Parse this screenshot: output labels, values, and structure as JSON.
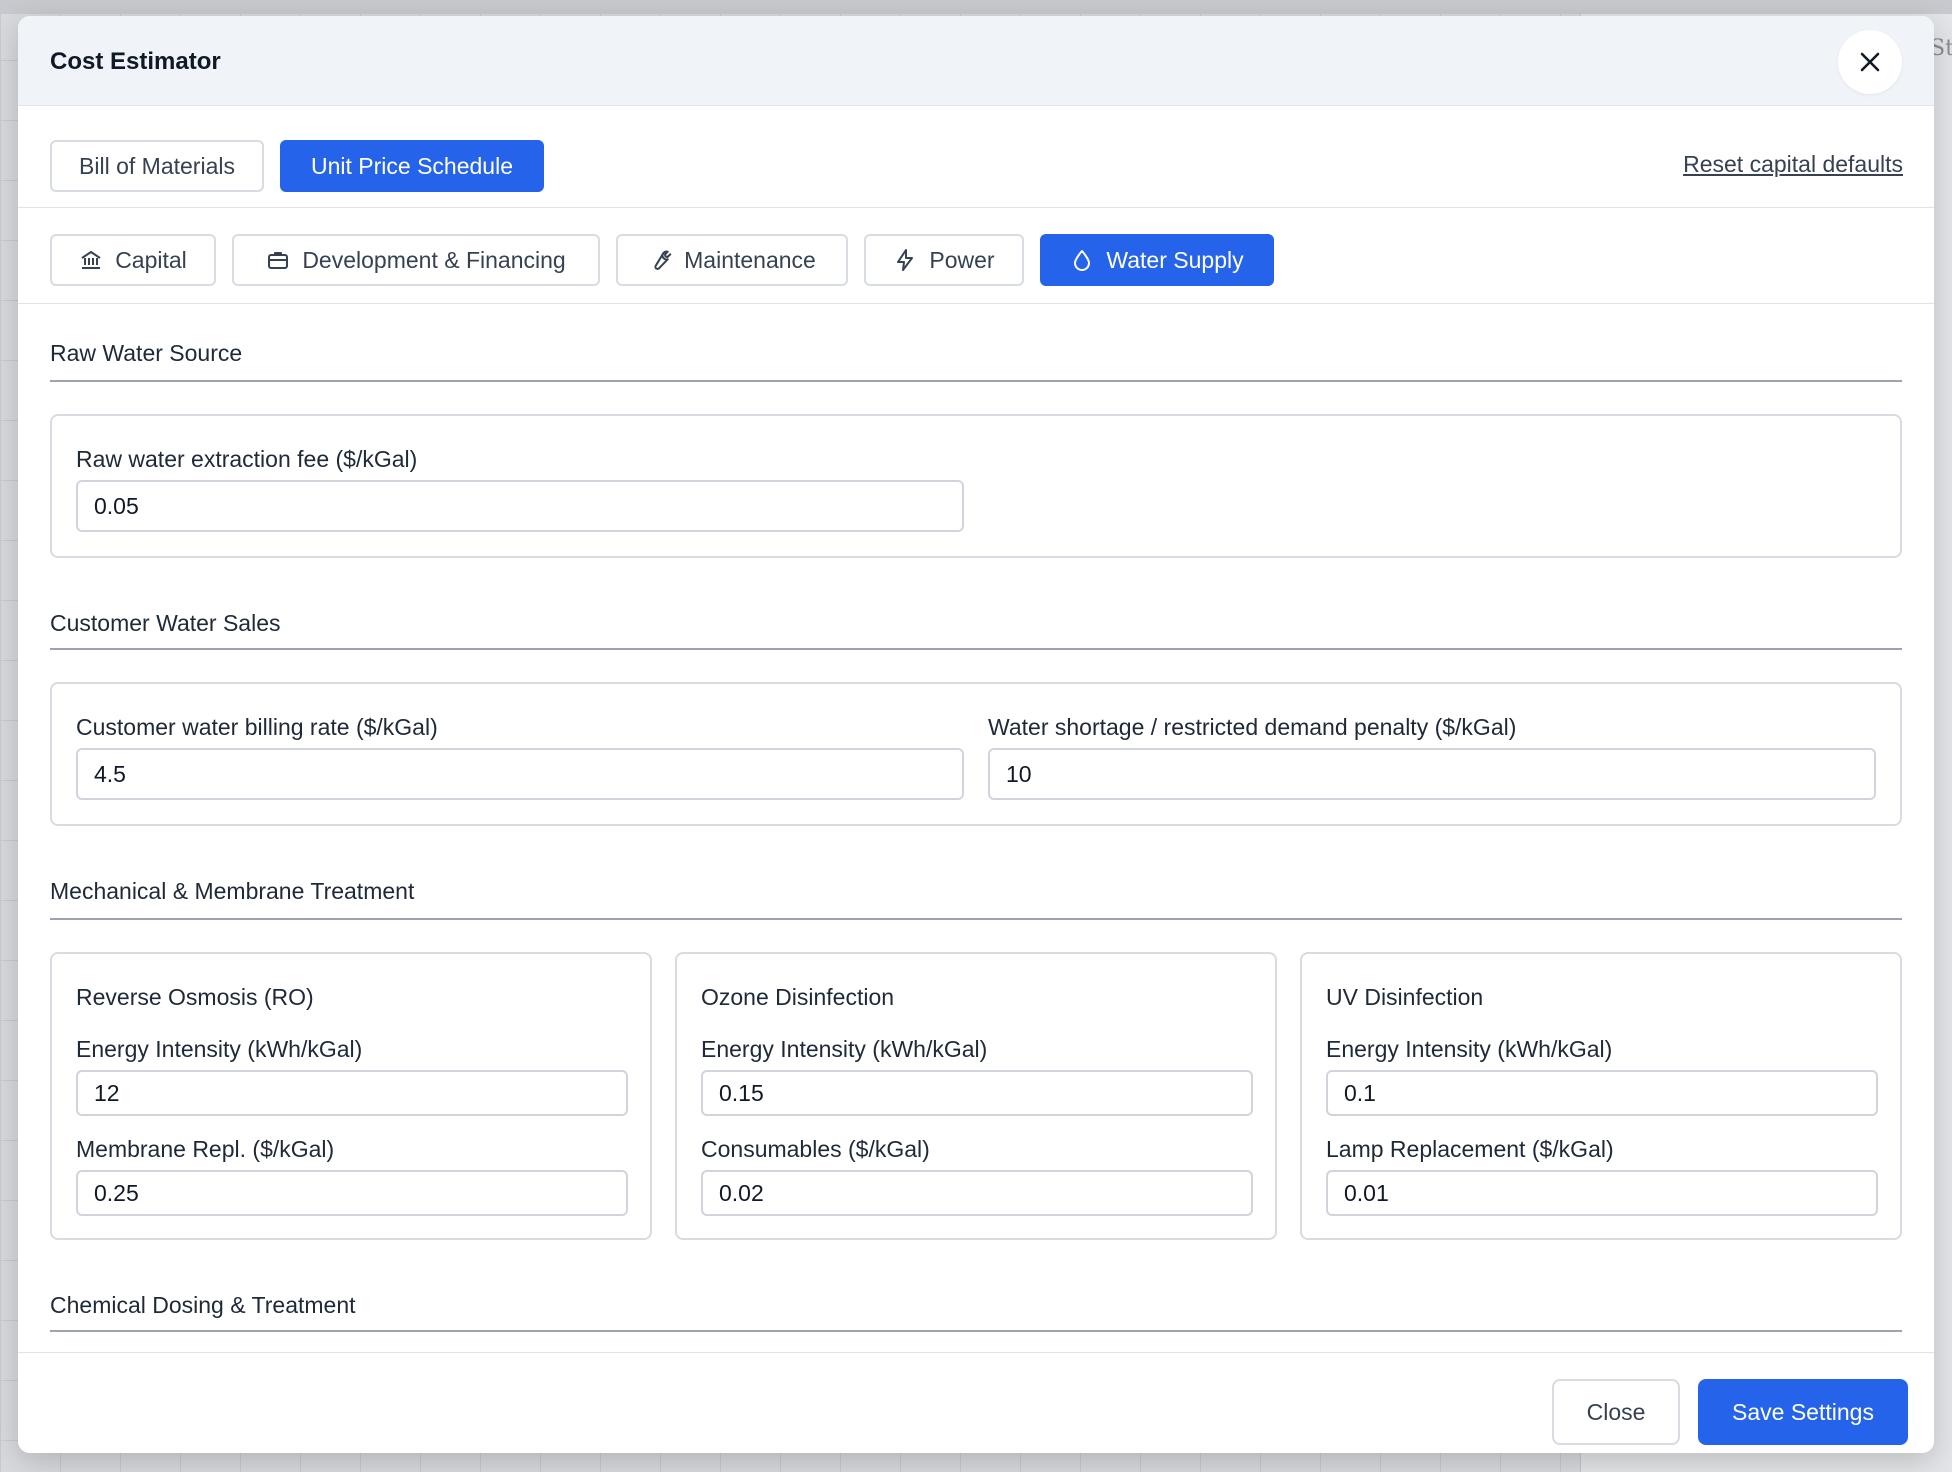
{
  "background": {
    "corner_text": "St"
  },
  "modal": {
    "title": "Cost Estimator",
    "close_icon": "close-icon"
  },
  "view_tabs": [
    {
      "label": "Bill of Materials",
      "active": false
    },
    {
      "label": "Unit Price Schedule",
      "active": true
    }
  ],
  "reset_link": "Reset capital defaults",
  "category_tabs": [
    {
      "label": "Capital",
      "icon": "bank-icon",
      "active": false
    },
    {
      "label": "Development & Financing",
      "icon": "briefcase-icon",
      "active": false
    },
    {
      "label": "Maintenance",
      "icon": "wrench-icon",
      "active": false
    },
    {
      "label": "Power",
      "icon": "bolt-icon",
      "active": false
    },
    {
      "label": "Water Supply",
      "icon": "droplet-icon",
      "active": true
    }
  ],
  "sections": {
    "raw_water": {
      "title": "Raw Water Source",
      "fields": [
        {
          "label": "Raw water extraction fee ($/kGal)",
          "value": "0.05"
        }
      ]
    },
    "customer_sales": {
      "title": "Customer Water Sales",
      "fields": [
        {
          "label": "Customer water billing rate ($/kGal)",
          "value": "4.5"
        },
        {
          "label": "Water shortage / restricted demand penalty ($/kGal)",
          "value": "10"
        }
      ]
    },
    "mechanical": {
      "title": "Mechanical & Membrane Treatment",
      "cards": [
        {
          "title": "Reverse Osmosis (RO)",
          "fields": [
            {
              "label": "Energy Intensity (kWh/kGal)",
              "value": "12"
            },
            {
              "label": "Membrane Repl. ($/kGal)",
              "value": "0.25"
            }
          ]
        },
        {
          "title": "Ozone Disinfection",
          "fields": [
            {
              "label": "Energy Intensity (kWh/kGal)",
              "value": "0.15"
            },
            {
              "label": "Consumables ($/kGal)",
              "value": "0.02"
            }
          ]
        },
        {
          "title": "UV Disinfection",
          "fields": [
            {
              "label": "Energy Intensity (kWh/kGal)",
              "value": "0.1"
            },
            {
              "label": "Lamp Replacement ($/kGal)",
              "value": "0.01"
            }
          ]
        }
      ]
    },
    "chemical": {
      "title": "Chemical Dosing & Treatment"
    }
  },
  "footer": {
    "close_label": "Close",
    "save_label": "Save Settings"
  },
  "colors": {
    "accent": "#2563eb",
    "header_bg": "#f0f3f8",
    "border": "#d7dbe2"
  }
}
